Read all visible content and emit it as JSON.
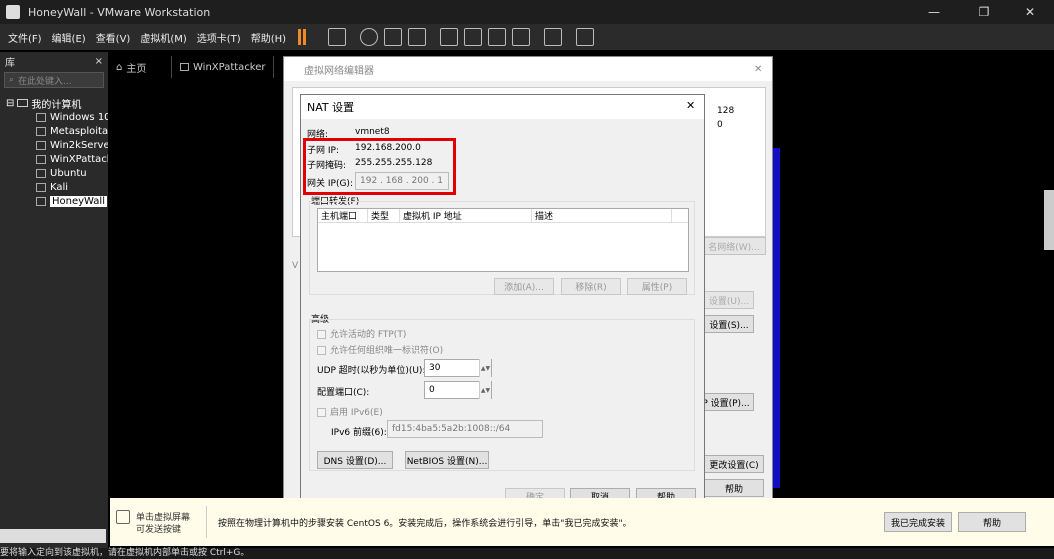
{
  "window": {
    "title": "HoneyWall - VMware Workstation",
    "minimize": "—",
    "maximize": "❐",
    "close": "✕"
  },
  "menu": [
    "文件(F)",
    "编辑(E)",
    "查看(V)",
    "虚拟机(M)",
    "选项卡(T)",
    "帮助(H)"
  ],
  "library": {
    "title": "库",
    "close": "×",
    "search_placeholder": "在此处键入...",
    "root": "我的计算机",
    "items": [
      "Windows 10",
      "Metasploitable",
      "Win2kServer",
      "WinXPattacker",
      "Ubuntu",
      "Kali",
      "HoneyWall"
    ],
    "selected": "HoneyWall"
  },
  "tabs": [
    {
      "label": "主页"
    },
    {
      "label": "WinXPattacker"
    }
  ],
  "vne": {
    "title": "虚拟网络编辑器",
    "close": "✕",
    "col_fragments": [
      "128",
      "0"
    ],
    "side_label": "V",
    "buttons": {
      "rename": "名网络(W)...",
      "settings_u": "设置(U)...",
      "settings_s": "设置(S)...",
      "dhcp": "P 设置(P)...",
      "apply": "更改设置(C)",
      "help": "帮助"
    }
  },
  "nat": {
    "title": "NAT 设置",
    "close": "✕",
    "network_label": "网络:",
    "network_value": "vmnet8",
    "subnet_ip_label": "子网 IP:",
    "subnet_ip_value": "192.168.200.0",
    "subnet_mask_label": "子网掩码:",
    "subnet_mask_value": "255.255.255.128",
    "gateway_label": "网关 IP(G):",
    "gateway_value": "192 . 168 . 200 . 1",
    "port_forward_label": "端口转发(F)",
    "table_headers": [
      "主机端口",
      "类型",
      "虚拟机 IP 地址",
      "描述"
    ],
    "add_btn": "添加(A)...",
    "remove_btn": "移除(R)",
    "props_btn": "属性(P)",
    "advanced_label": "高级",
    "ftp_label": "允许活动的 FTP(T)",
    "oui_label": "允许任何组织唯一标识符(O)",
    "udp_label": "UDP 超时(以秒为单位)(U):",
    "udp_value": "30",
    "config_port_label": "配置端口(C):",
    "config_port_value": "0",
    "ipv6_label": "启用 IPv6(E)",
    "ipv6_prefix_label": "IPv6 前缀(6):",
    "ipv6_prefix_value": "fd15:4ba5:5a2b:1008::/64",
    "dns_btn": "DNS 设置(D)...",
    "netbios_btn": "NetBIOS 设置(N)...",
    "ok_btn": "确定",
    "cancel_btn": "取消",
    "help_btn": "帮助"
  },
  "hint": {
    "left_line1": "单击虚拟屏幕",
    "left_line2": "可发送按键",
    "message": "按照在物理计算机中的步骤安装 CentOS 6。安装完成后，操作系统会进行引导，单击\"我已完成安装\"。",
    "done_btn": "我已完成安装",
    "help_btn": "帮助"
  },
  "status": {
    "text": "要将输入定向到该虚拟机，请在虚拟机内部单击或按 Ctrl+G。"
  },
  "colors": {
    "highlight": "#e00000",
    "accent_blue": "#1010c0"
  }
}
